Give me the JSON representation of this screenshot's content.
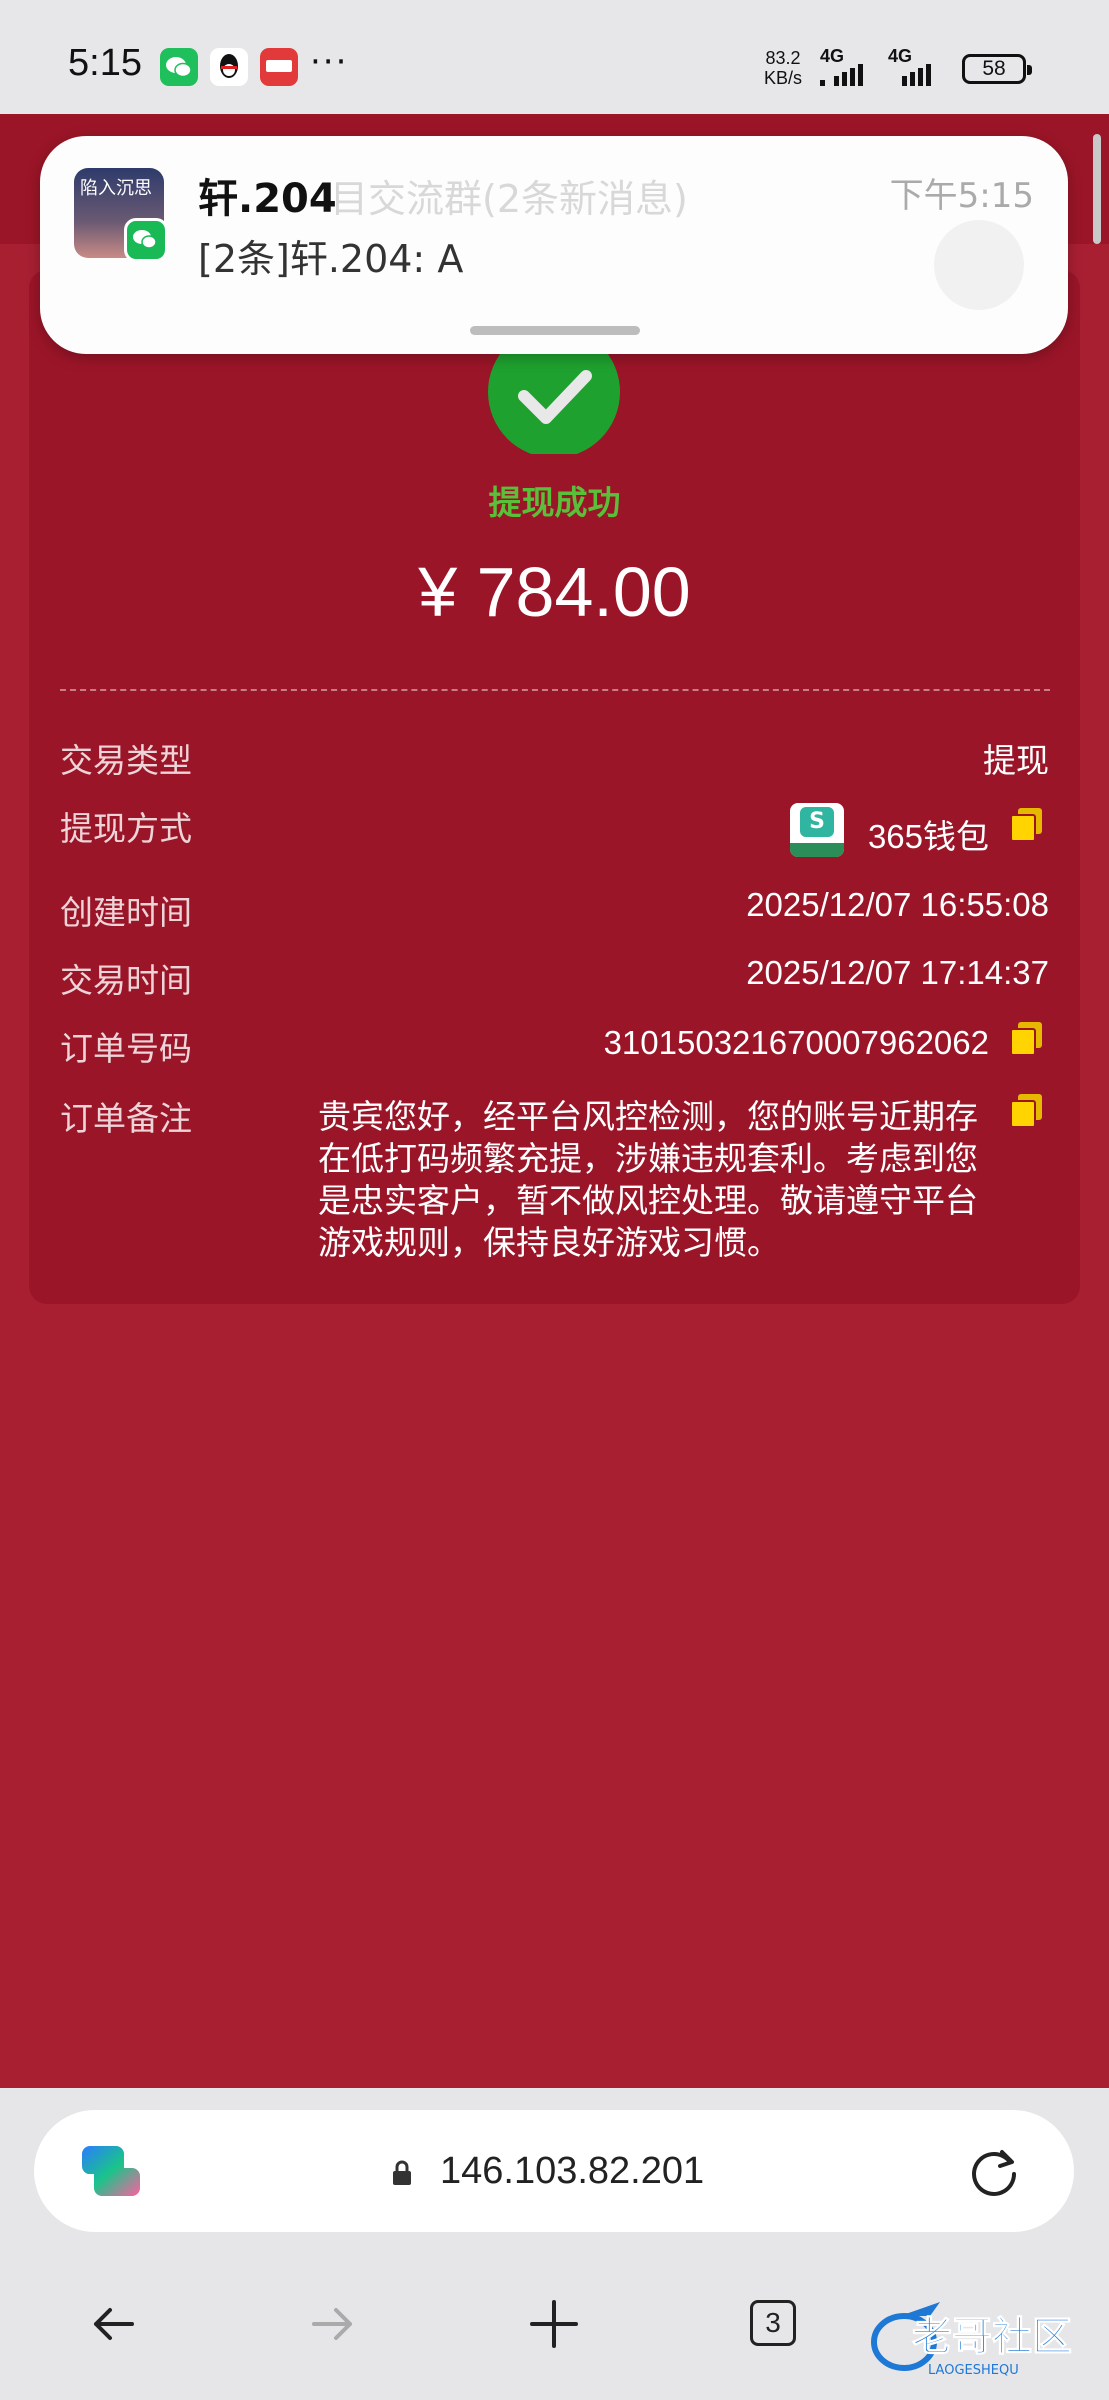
{
  "status_bar": {
    "time": "5:15",
    "more": "···",
    "net_speed_value": "83.2",
    "net_speed_unit": "KB/s",
    "signal1_label": "4G",
    "signal2_label": "4G",
    "battery": "58",
    "icons": [
      "wechat-icon",
      "qq-icon",
      "kandian-app-icon"
    ]
  },
  "notification": {
    "avatar_text": "陷入沉思",
    "sender": "轩.204",
    "behind_title": "目交流群(2条新消息)",
    "message": "[2条]轩.204: A",
    "time": "下午5:15"
  },
  "result": {
    "status": "提现成功",
    "amount": "¥ 784.00",
    "status_color": "#59c03a"
  },
  "details": {
    "type_label": "交易类型",
    "type_value": "提现",
    "method_label": "提现方式",
    "method_value": "365钱包",
    "method_logo_text": "S",
    "created_label": "创建时间",
    "created_value": "2025/12/07 16:55:08",
    "trade_label": "交易时间",
    "trade_value": "2025/12/07 17:14:37",
    "order_label": "订单号码",
    "order_value": "3101503216700079620​62",
    "remark_label": "订单备注",
    "remark_value": "贵宾您好，经平台风控检测，您的账号近期存在低打码频繁充提，涉嫌违规套利。考虑到您是忠实客户，暂不做风控处理。敬请遵守平台游戏规则，保持良好游戏习惯。"
  },
  "browser": {
    "url": "146.103.82.201",
    "tab_count": "3"
  },
  "watermark": {
    "text": "老哥社区",
    "sub": "LAOGESHEQU"
  },
  "colors": {
    "page_bg": "#a81f32",
    "card_bg": "#9b1528",
    "copy_icon": "#ffd400"
  }
}
